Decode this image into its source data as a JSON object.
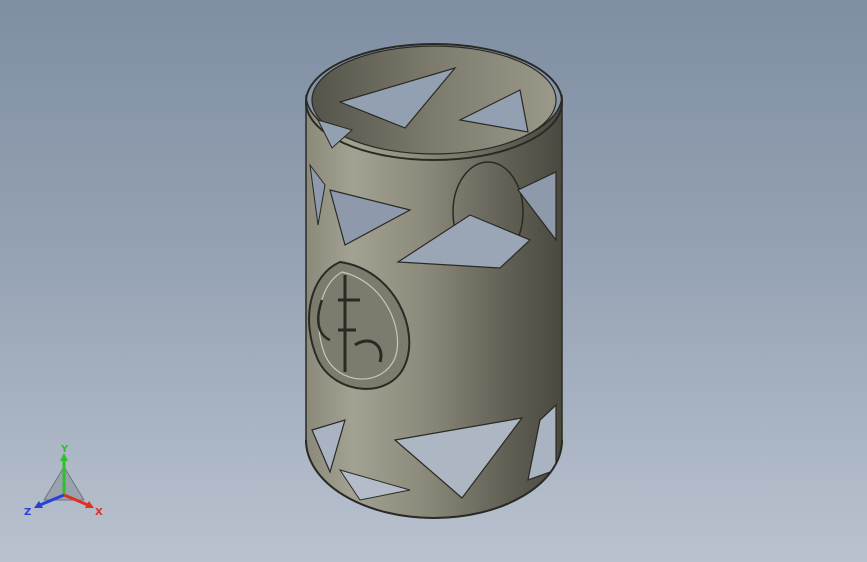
{
  "viewport": {
    "background_top": "#7f8ea3",
    "background_bottom": "#b9c2cf"
  },
  "model": {
    "part": "perforated-cylinder",
    "surface_color": "#6f6e62",
    "edge_color": "#2a2a24"
  },
  "triad": {
    "x_label": "X",
    "y_label": "Y",
    "z_label": "Z",
    "x_color": "#e0301e",
    "y_color": "#2fbf2f",
    "z_color": "#2a3fd6"
  }
}
